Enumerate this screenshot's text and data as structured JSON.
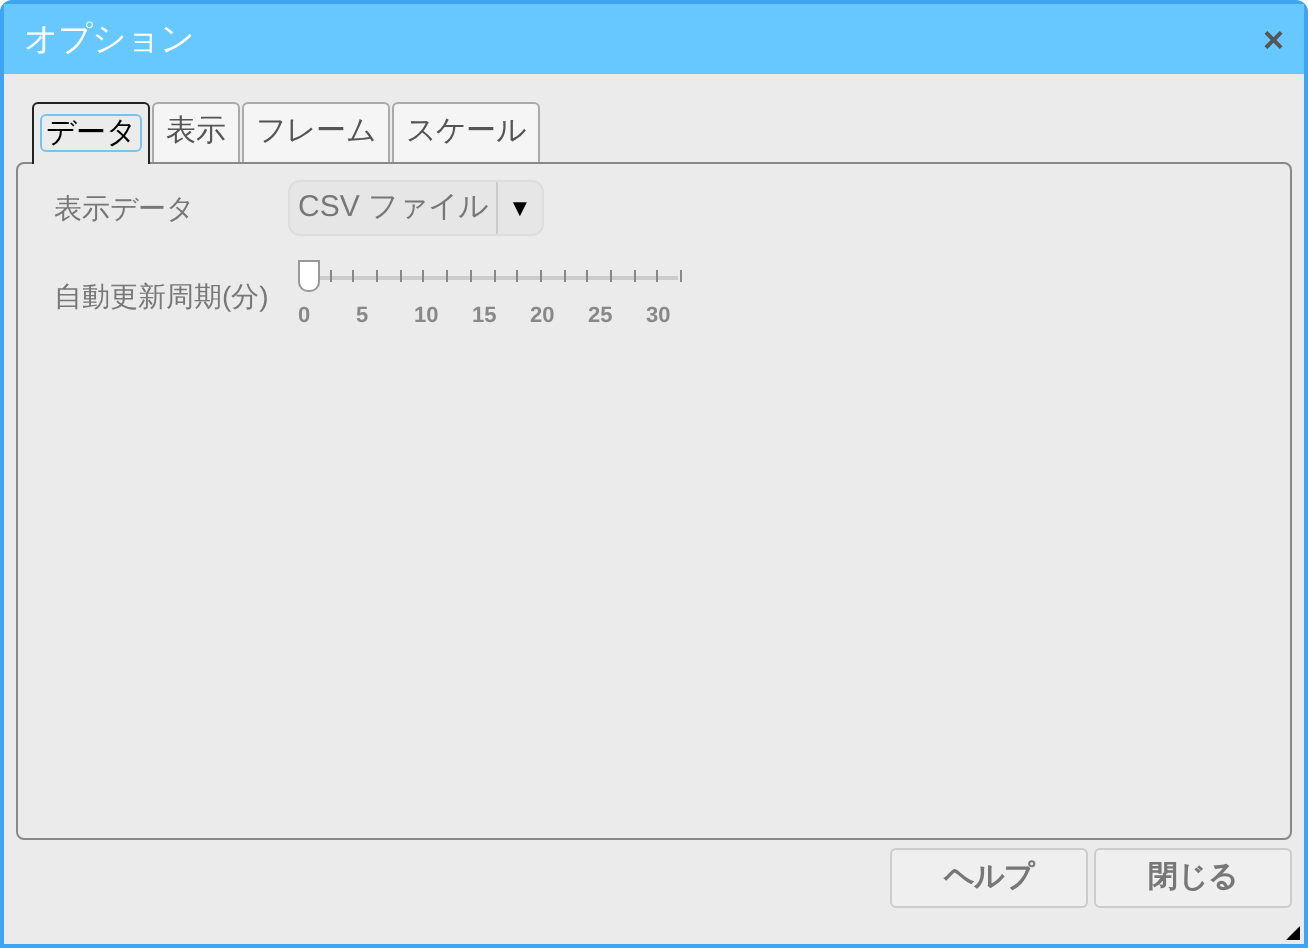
{
  "window": {
    "title": "オプション",
    "close": "×"
  },
  "tabs": [
    {
      "label": "データ",
      "selected": true
    },
    {
      "label": "表示",
      "selected": false
    },
    {
      "label": "フレーム",
      "selected": false
    },
    {
      "label": "スケール",
      "selected": false
    }
  ],
  "display_data": {
    "label": "表示データ",
    "value": "CSV ファイル",
    "arrow": "▼"
  },
  "refresh": {
    "label": "自動更新周期(分)",
    "level": 0,
    "tick_labels": [
      "0",
      "5",
      "10",
      "15",
      "20",
      "25",
      "30"
    ]
  },
  "buttons": [
    "ヘルプ",
    "閉じる"
  ]
}
